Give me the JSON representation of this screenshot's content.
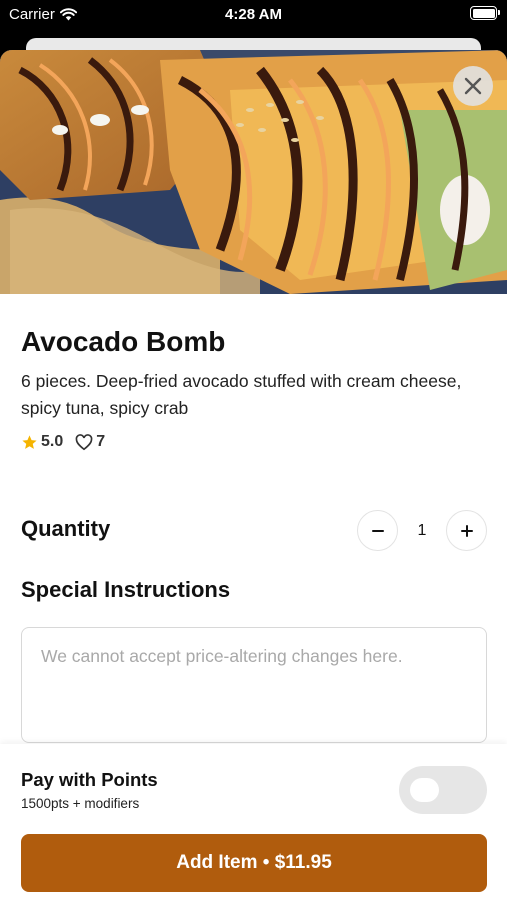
{
  "status_bar": {
    "carrier": "Carrier",
    "time": "4:28 AM"
  },
  "item": {
    "title": "Avocado Bomb",
    "description": "6 pieces. Deep-fried avocado stuffed with cream cheese, spicy tuna, spicy crab",
    "rating": "5.0",
    "likes": "7",
    "image_icon": "food-photo"
  },
  "quantity": {
    "label": "Quantity",
    "value": "1",
    "decrement_icon": "minus-icon",
    "increment_icon": "plus-icon"
  },
  "special_instructions": {
    "label": "Special Instructions",
    "value": "",
    "placeholder": "We cannot accept price-altering changes here."
  },
  "points": {
    "title": "Pay with Points",
    "subtitle": "1500pts + modifiers",
    "enabled": false
  },
  "add_button": {
    "label": "Add Item • $11.95"
  },
  "colors": {
    "accent": "#b05c0d",
    "star": "#f5b400",
    "toggle_off": "#e6e6e6"
  }
}
